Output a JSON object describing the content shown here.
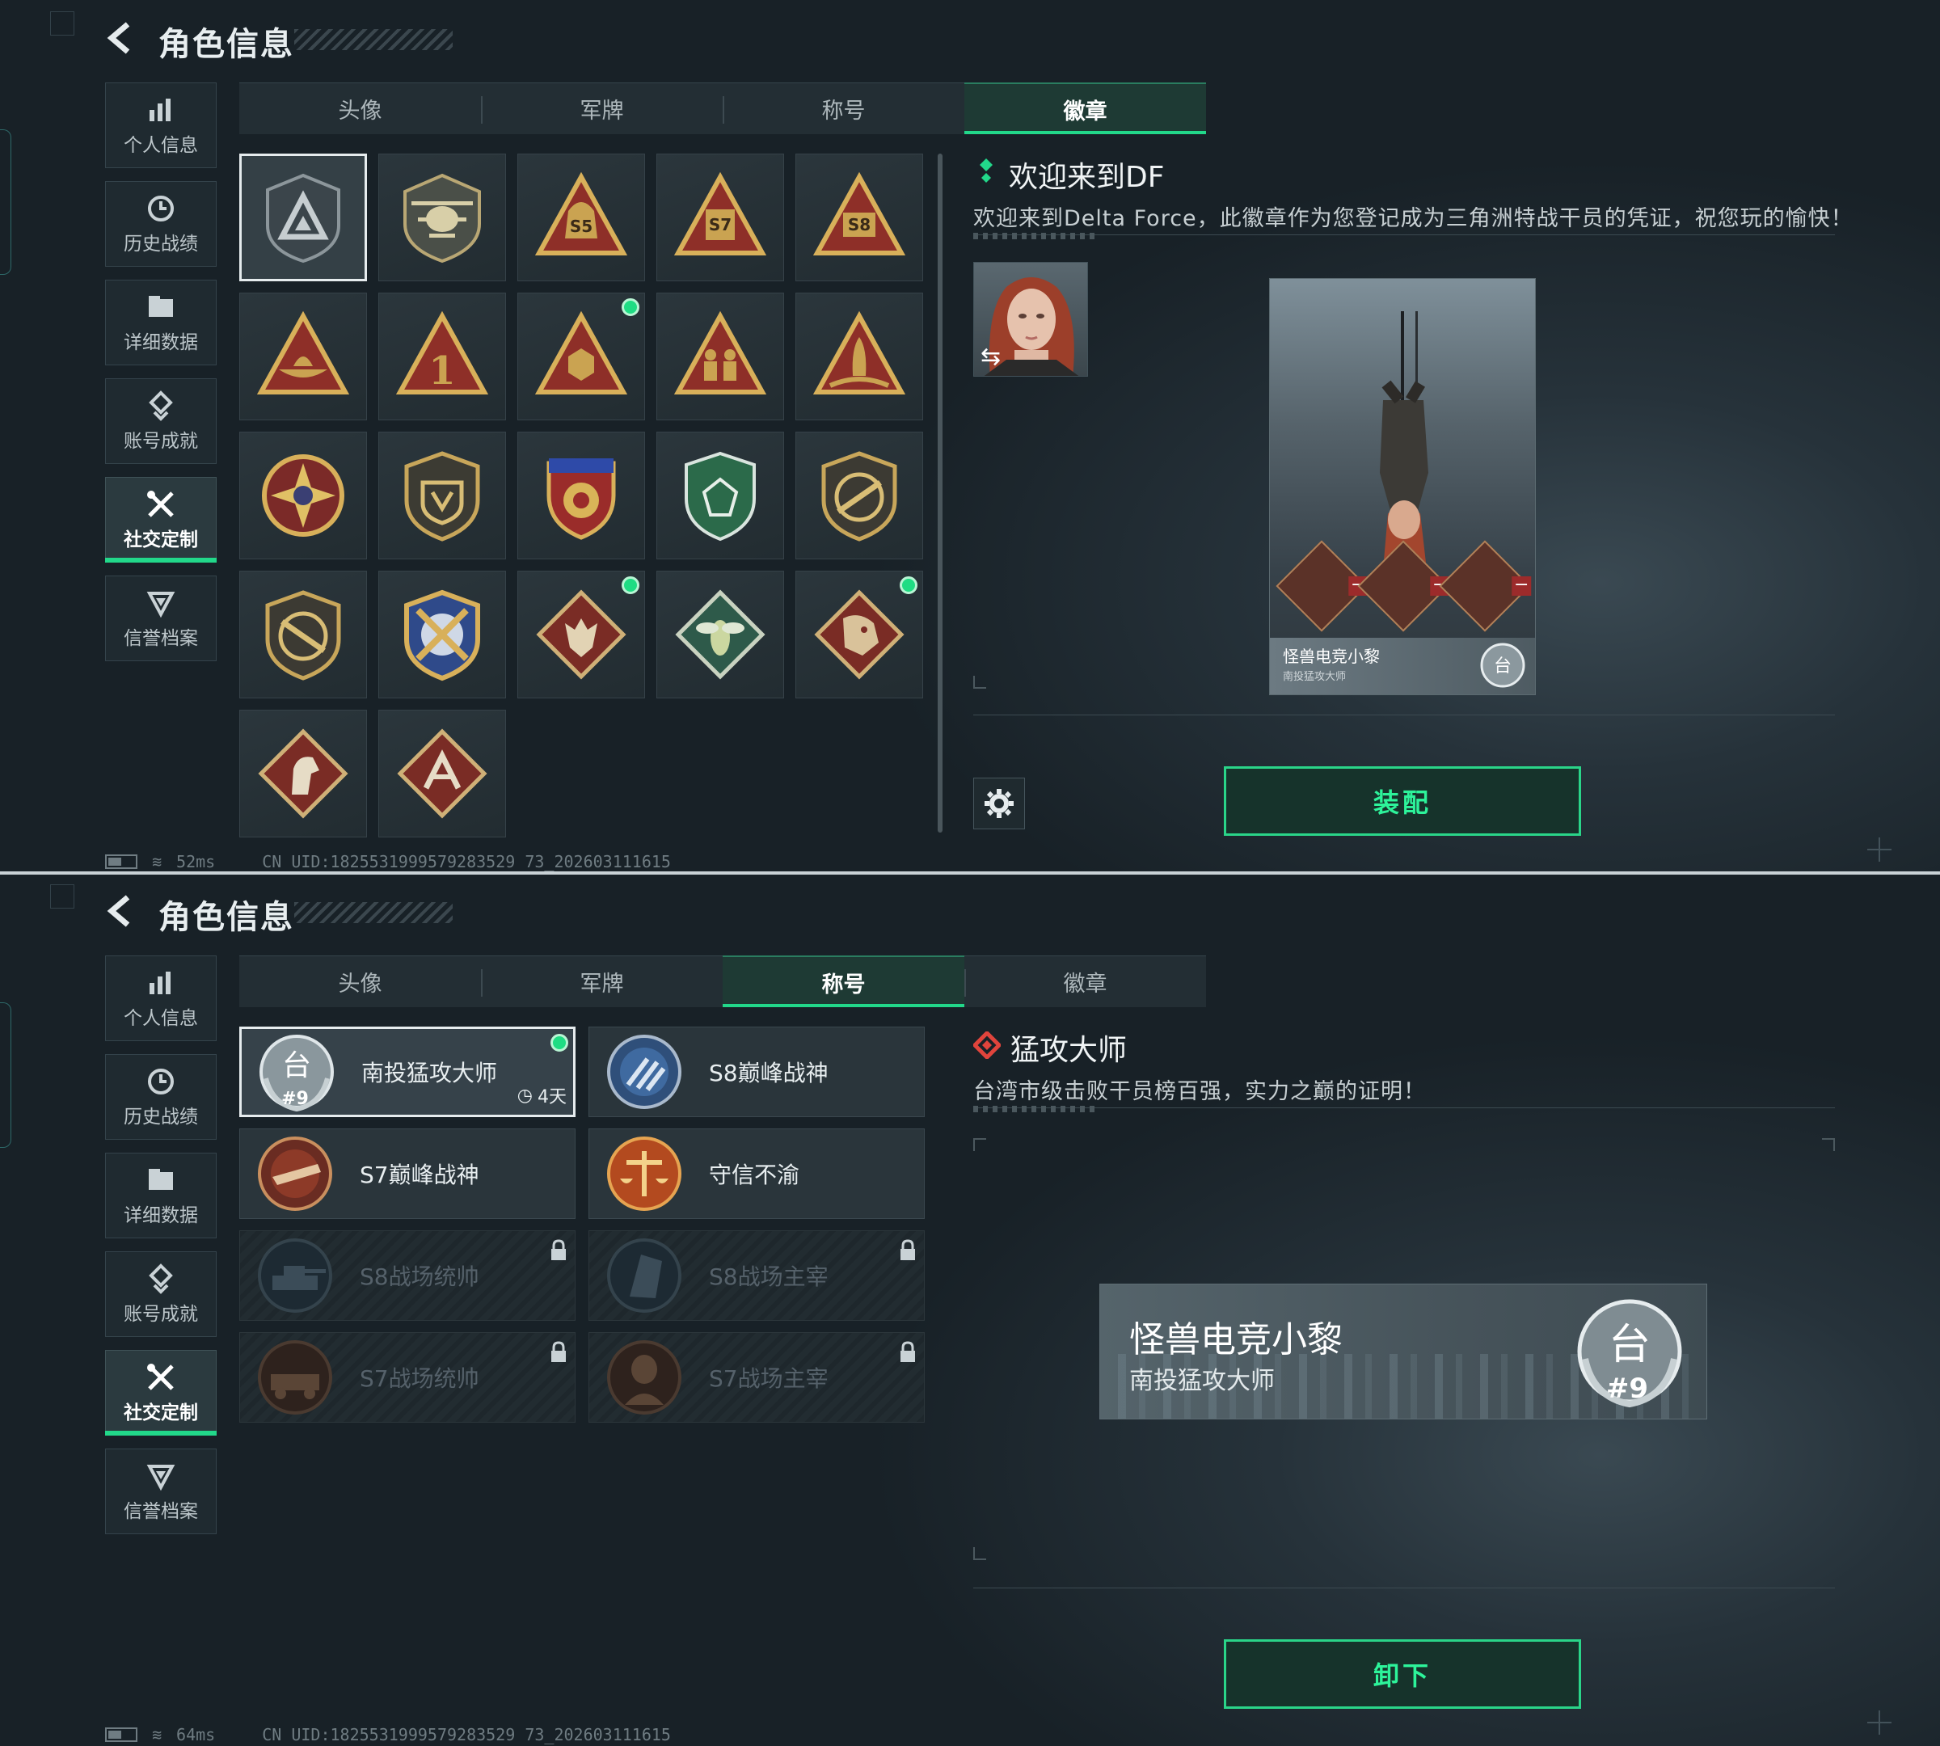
{
  "top": {
    "header": {
      "title": "角色信息"
    },
    "sidenav": [
      {
        "label": "个人信息",
        "icon": "bar-chart-icon"
      },
      {
        "label": "历史战绩",
        "icon": "history-clock-icon"
      },
      {
        "label": "详细数据",
        "icon": "folder-icon"
      },
      {
        "label": "账号成就",
        "icon": "achievement-icon"
      },
      {
        "label": "社交定制",
        "icon": "tools-icon",
        "active": true
      },
      {
        "label": "信誉档案",
        "icon": "reputation-icon"
      }
    ],
    "tabs": [
      {
        "label": "头像"
      },
      {
        "label": "军牌"
      },
      {
        "label": "称号"
      },
      {
        "label": "徽章",
        "active": true
      }
    ],
    "badges": [
      {
        "icon": "delta-shield-badge",
        "selected": true
      },
      {
        "icon": "helicopter-badge"
      },
      {
        "icon": "s5-triangle-badge"
      },
      {
        "icon": "s7-triangle-badge"
      },
      {
        "icon": "s8-triangle-badge"
      },
      {
        "icon": "boat-triangle-badge"
      },
      {
        "icon": "number-one-triangle-badge"
      },
      {
        "icon": "hexagon-triangle-badge",
        "new": true
      },
      {
        "icon": "soldiers-triangle-badge"
      },
      {
        "icon": "rocket-triangle-badge"
      },
      {
        "icon": "star-medal-badge"
      },
      {
        "icon": "shield-emblem-badge"
      },
      {
        "icon": "crest-stars-badge"
      },
      {
        "icon": "green-shield-badge"
      },
      {
        "icon": "rifle-shield-badge"
      },
      {
        "icon": "rifle-shield-badge-2"
      },
      {
        "icon": "crossed-arms-badge"
      },
      {
        "icon": "wolf-diamond-badge",
        "new": true
      },
      {
        "icon": "wasp-diamond-badge"
      },
      {
        "icon": "dragon-diamond-badge",
        "new": true
      },
      {
        "icon": "horse-diamond-badge"
      },
      {
        "icon": "ai-diamond-badge"
      }
    ],
    "detail": {
      "title": "欢迎来到DF",
      "description": "欢迎来到Delta Force，此徽章作为您登记成为三角洲特战干员的凭证，祝您玩的愉快！",
      "card_name": "怪兽电竞小黎",
      "card_title": "南投猛攻大师"
    },
    "action_label": "装配",
    "status": {
      "ping": "52ms",
      "uid": "CN UID:1825531999579283529 73_202603111615"
    }
  },
  "bottom": {
    "header": {
      "title": "角色信息"
    },
    "sidenav": [
      {
        "label": "个人信息",
        "icon": "bar-chart-icon"
      },
      {
        "label": "历史战绩",
        "icon": "history-clock-icon"
      },
      {
        "label": "详细数据",
        "icon": "folder-icon"
      },
      {
        "label": "账号成就",
        "icon": "achievement-icon"
      },
      {
        "label": "社交定制",
        "icon": "tools-icon",
        "active": true
      },
      {
        "label": "信誉档案",
        "icon": "reputation-icon"
      }
    ],
    "tabs": [
      {
        "label": "头像"
      },
      {
        "label": "军牌"
      },
      {
        "label": "称号",
        "active": true
      },
      {
        "label": "徽章"
      }
    ],
    "titles": [
      {
        "name": "南投猛攻大师",
        "timer": "4天",
        "selected": true,
        "icon": "taiwan-emblem-icon",
        "emblem_text": "台",
        "emblem_num": "#9"
      },
      {
        "name": "S8巅峰战神",
        "icon": "s8-peak-emblem-icon"
      },
      {
        "name": "S7巅峰战神",
        "icon": "s7-peak-emblem-icon"
      },
      {
        "name": "守信不渝",
        "icon": "scales-emblem-icon"
      },
      {
        "name": "S8战场统帅",
        "locked": true,
        "icon": "tank-emblem-icon"
      },
      {
        "name": "S8战场主宰",
        "locked": true,
        "icon": "building-emblem-icon"
      },
      {
        "name": "S7战场统帅",
        "locked": true,
        "icon": "vehicle-emblem-icon"
      },
      {
        "name": "S7战场主宰",
        "locked": true,
        "icon": "soldier-emblem-icon"
      }
    ],
    "detail": {
      "title": "猛攻大师",
      "description": "台湾市级击败干员榜百强，实力之巅的证明！",
      "plate_name": "怪兽电竞小黎",
      "plate_title": "南投猛攻大师",
      "plate_emblem_char": "台",
      "plate_emblem_num": "#9"
    },
    "action_label": "卸下",
    "status": {
      "ping": "64ms",
      "uid": "CN UID:1825531999579283529 73_202603111615"
    }
  },
  "colors": {
    "accent": "#22d88a",
    "background": "#1e2a31",
    "locked_text": "#55616a",
    "badge_gold": "#c9a24e",
    "badge_red": "#8e2f28"
  }
}
